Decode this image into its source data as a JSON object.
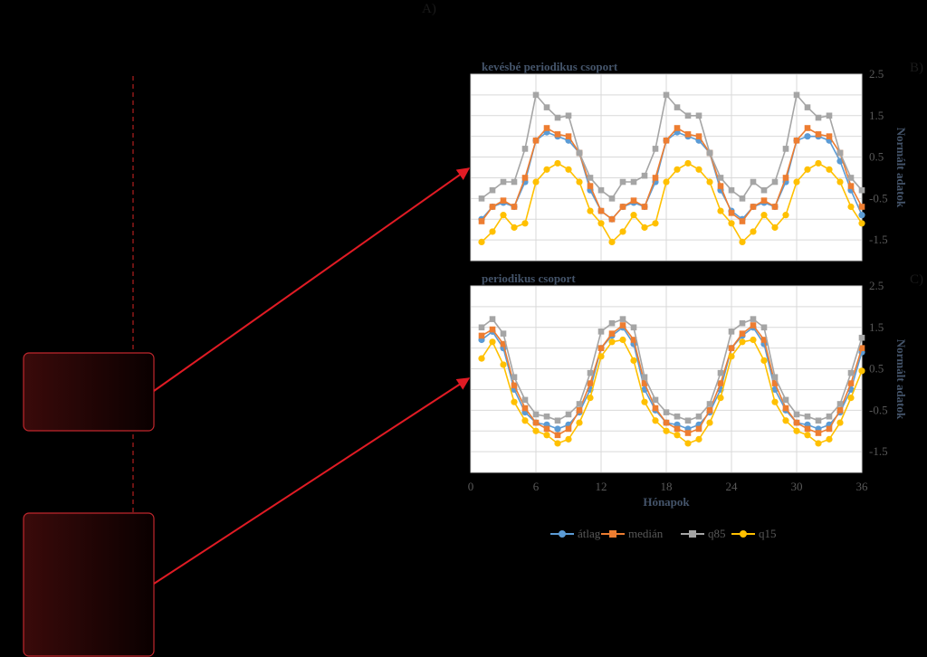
{
  "panel_labels": {
    "a": "A)",
    "b": "B)",
    "c": "C)"
  },
  "colors": {
    "background": "#000000",
    "grid": "#d9d9d9",
    "arrow": "#e01b24",
    "box_fill_start": "#3a0a0a",
    "box_fill_end": "#0a0000",
    "box_stroke": "#c0272d",
    "dashed_line": "#a51d1d"
  },
  "legend": [
    {
      "name": "átlag",
      "color": "#5b9bd5"
    },
    {
      "name": "medián",
      "color": "#ed7d31"
    },
    {
      "name": "q85",
      "color": "#a5a5a5"
    },
    {
      "name": "q15",
      "color": "#ffc000"
    }
  ],
  "chart_data": [
    {
      "type": "line",
      "title": "kevésbé periodikus csoport",
      "xlabel": "",
      "ylabel": "Normált adatok",
      "xlim": [
        0,
        36
      ],
      "ylim": [
        -2,
        2.5
      ],
      "x_ticks": [],
      "y_ticks": [
        2.5,
        1.5,
        0.5,
        -0.5,
        -1.5
      ],
      "grid": true,
      "x": [
        1,
        2,
        3,
        4,
        5,
        6,
        7,
        8,
        9,
        10,
        11,
        12,
        13,
        14,
        15,
        16,
        17,
        18,
        19,
        20,
        21,
        22,
        23,
        24,
        25,
        26,
        27,
        28,
        29,
        30,
        31,
        32,
        33,
        34,
        35,
        36
      ],
      "series": [
        {
          "name": "átlag",
          "color": "#5b9bd5",
          "values": [
            -1.0,
            -0.7,
            -0.6,
            -0.7,
            -0.1,
            0.9,
            1.1,
            1.0,
            0.9,
            0.6,
            -0.3,
            -0.8,
            -1.0,
            -0.7,
            -0.6,
            -0.7,
            -0.1,
            0.9,
            1.1,
            1.0,
            0.9,
            0.6,
            -0.3,
            -0.8,
            -1.0,
            -0.7,
            -0.6,
            -0.7,
            -0.1,
            0.9,
            1.0,
            1.0,
            0.9,
            0.4,
            -0.3,
            -0.9
          ]
        },
        {
          "name": "medián",
          "color": "#ed7d31",
          "values": [
            -1.05,
            -0.7,
            -0.55,
            -0.7,
            0.0,
            0.9,
            1.2,
            1.05,
            1.0,
            0.6,
            -0.2,
            -0.8,
            -1.0,
            -0.7,
            -0.55,
            -0.7,
            0.0,
            0.9,
            1.2,
            1.05,
            1.0,
            0.6,
            -0.2,
            -0.85,
            -1.05,
            -0.7,
            -0.55,
            -0.7,
            0.0,
            0.9,
            1.2,
            1.05,
            1.0,
            0.6,
            -0.2,
            -0.7
          ]
        },
        {
          "name": "q85",
          "color": "#a5a5a5",
          "values": [
            -0.5,
            -0.3,
            -0.1,
            -0.1,
            0.7,
            2.0,
            1.7,
            1.45,
            1.5,
            0.6,
            0.0,
            -0.3,
            -0.5,
            -0.1,
            -0.1,
            0.05,
            0.7,
            2.0,
            1.7,
            1.5,
            1.5,
            0.6,
            0.0,
            -0.3,
            -0.5,
            -0.1,
            -0.3,
            -0.1,
            0.7,
            2.0,
            1.7,
            1.45,
            1.5,
            0.6,
            0.0,
            -0.3
          ]
        },
        {
          "name": "q15",
          "color": "#ffc000",
          "values": [
            -1.55,
            -1.3,
            -0.9,
            -1.2,
            -1.1,
            -0.1,
            0.2,
            0.35,
            0.2,
            -0.1,
            -0.8,
            -1.1,
            -1.55,
            -1.3,
            -0.9,
            -1.2,
            -1.1,
            -0.1,
            0.2,
            0.35,
            0.2,
            -0.1,
            -0.8,
            -1.1,
            -1.55,
            -1.3,
            -0.9,
            -1.2,
            -0.9,
            -0.1,
            0.2,
            0.35,
            0.2,
            -0.1,
            -0.7,
            -1.1
          ]
        }
      ]
    },
    {
      "type": "line",
      "title": "periodikus csoport",
      "xlabel": "Hónapok",
      "ylabel": "Normált adatok",
      "xlim": [
        0,
        36
      ],
      "ylim": [
        -2,
        2.5
      ],
      "x_ticks": [
        0,
        6,
        12,
        18,
        24,
        30,
        36
      ],
      "y_ticks": [
        2.5,
        1.5,
        0.5,
        -0.5,
        -1.5
      ],
      "grid": true,
      "legend_position": "bottom",
      "x": [
        1,
        2,
        3,
        4,
        5,
        6,
        7,
        8,
        9,
        10,
        11,
        12,
        13,
        14,
        15,
        16,
        17,
        18,
        19,
        20,
        21,
        22,
        23,
        24,
        25,
        26,
        27,
        28,
        29,
        30,
        31,
        32,
        33,
        34,
        35,
        36
      ],
      "series": [
        {
          "name": "átlag",
          "color": "#5b9bd5",
          "values": [
            1.2,
            1.4,
            1.0,
            0.0,
            -0.55,
            -0.8,
            -0.85,
            -0.95,
            -0.85,
            -0.55,
            0.0,
            1.0,
            1.3,
            1.5,
            1.1,
            0.0,
            -0.5,
            -0.8,
            -0.85,
            -0.95,
            -0.85,
            -0.55,
            0.0,
            1.0,
            1.3,
            1.5,
            1.1,
            0.0,
            -0.5,
            -0.8,
            -0.85,
            -0.95,
            -0.85,
            -0.55,
            0.0,
            0.9
          ]
        },
        {
          "name": "medián",
          "color": "#ed7d31",
          "values": [
            1.3,
            1.45,
            1.1,
            0.1,
            -0.45,
            -0.8,
            -0.95,
            -1.1,
            -0.95,
            -0.5,
            0.15,
            1.0,
            1.35,
            1.55,
            1.2,
            0.15,
            -0.45,
            -0.8,
            -0.95,
            -1.05,
            -0.95,
            -0.5,
            0.15,
            1.0,
            1.35,
            1.55,
            1.2,
            0.15,
            -0.45,
            -0.8,
            -0.95,
            -1.05,
            -0.95,
            -0.5,
            0.15,
            1.0
          ]
        },
        {
          "name": "q85",
          "color": "#a5a5a5",
          "values": [
            1.5,
            1.7,
            1.35,
            0.3,
            -0.25,
            -0.6,
            -0.65,
            -0.75,
            -0.6,
            -0.35,
            0.4,
            1.4,
            1.6,
            1.7,
            1.5,
            0.3,
            -0.25,
            -0.55,
            -0.65,
            -0.75,
            -0.65,
            -0.35,
            0.4,
            1.4,
            1.6,
            1.7,
            1.5,
            0.3,
            -0.25,
            -0.6,
            -0.65,
            -0.75,
            -0.65,
            -0.35,
            0.4,
            1.25
          ]
        },
        {
          "name": "q15",
          "color": "#ffc000",
          "values": [
            0.75,
            1.15,
            0.6,
            -0.3,
            -0.75,
            -1.0,
            -1.1,
            -1.3,
            -1.2,
            -0.8,
            -0.2,
            0.8,
            1.15,
            1.2,
            0.7,
            -0.3,
            -0.75,
            -1.0,
            -1.1,
            -1.3,
            -1.2,
            -0.8,
            -0.2,
            0.8,
            1.15,
            1.2,
            0.7,
            -0.3,
            -0.75,
            -1.0,
            -1.1,
            -1.3,
            -1.2,
            -0.8,
            -0.2,
            0.45
          ]
        }
      ]
    }
  ]
}
